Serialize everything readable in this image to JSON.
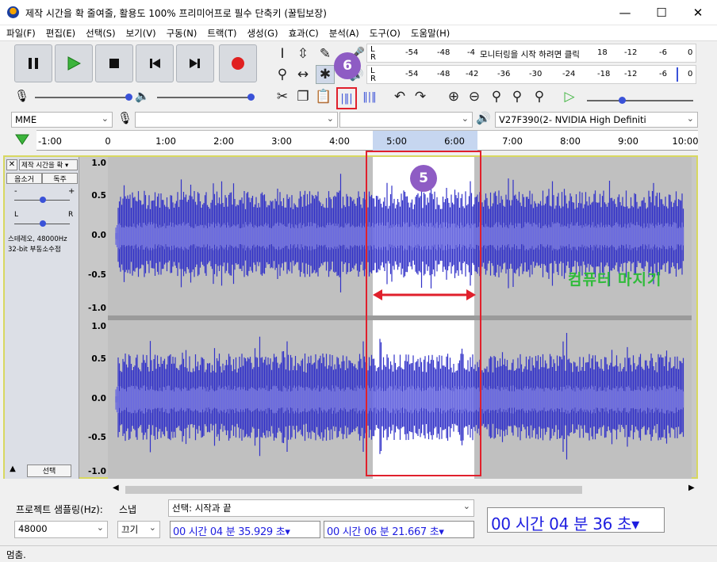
{
  "window": {
    "title": "제작 시간을 확 줄여줄, 활용도 100% 프리미어프로 필수 단축키 (꿀팁보장)",
    "minimize": "—",
    "maximize": "☐",
    "close": "✕"
  },
  "menu": [
    "파일(F)",
    "편집(E)",
    "선택(S)",
    "보기(V)",
    "구동(N)",
    "트랙(T)",
    "생성(G)",
    "효과(C)",
    "분석(A)",
    "도구(O)",
    "도움말(H)"
  ],
  "meters": {
    "record_hint": "모니터링을 시작 하려면 클릭",
    "record_ticks": [
      "-54",
      "-48",
      "-4",
      "18",
      "-12",
      "-6",
      "0"
    ],
    "play_ticks": [
      "-54",
      "-48",
      "-42",
      "-36",
      "-30",
      "-24",
      "-18",
      "-12",
      "-6",
      "0"
    ],
    "l": "L",
    "r": "R"
  },
  "devices": {
    "host": "MME",
    "input": "",
    "input_channels": "",
    "output": "V27F390(2- NVIDIA High Definiti"
  },
  "ruler": {
    "ticks": [
      "-1:00",
      "0",
      "1:00",
      "2:00",
      "3:00",
      "4:00",
      "5:00",
      "6:00",
      "7:00",
      "8:00",
      "9:00",
      "10:00"
    ]
  },
  "track": {
    "name": "제작 시간을 확",
    "mute": "음소거",
    "solo": "독주",
    "gain_minus": "-",
    "gain_plus": "+",
    "pan_l": "L",
    "pan_r": "R",
    "info": "스테레오, 48000Hz\n32-bit 부동소수점",
    "select": "선택",
    "scale": [
      "1.0",
      "0.5",
      "0.0",
      "-0.5",
      "-1.0"
    ]
  },
  "badges": {
    "five": "5",
    "six": "6"
  },
  "watermark": "컴퓨터 마지기",
  "bottom": {
    "rate_label": "프로젝트 샘플링(Hz):",
    "rate_value": "48000",
    "snap_label": "스냅",
    "snap_value": "끄기",
    "sel_mode": "선택: 시작과 끝",
    "sel_start": "00 시간 04 분 35.929 초",
    "sel_end": "00 시간 06 분 21.667 초",
    "position": "00 시간 04 분 36 초"
  },
  "status": "멈춤.",
  "colors": {
    "wave": "#3232c8",
    "wave_light": "#6464dc",
    "selection": "#ffffff",
    "highlight": "#e0202c",
    "badge": "#8e5cc4"
  }
}
